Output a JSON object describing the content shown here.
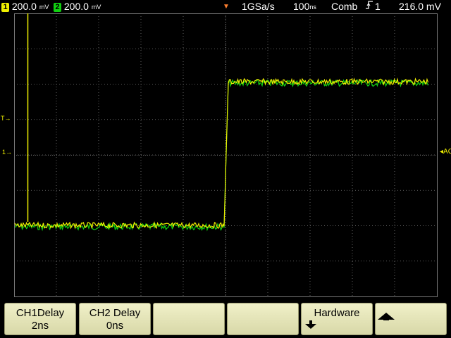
{
  "status": {
    "ch1_number": "1",
    "ch1_scale": "200.0",
    "ch1_unit": "mV",
    "ch2_number": "2",
    "ch2_scale": "200.0",
    "ch2_unit": "mV",
    "sample_rate": "1GSa/s",
    "timebase": "100",
    "timebase_unit": "ns",
    "acq_mode": "Comb",
    "trigger_slope_icon": "rising-edge-icon",
    "trigger_source": "1",
    "trigger_level": "216.0 mV"
  },
  "markers": {
    "trigger_pos_icon": "trigger-position-icon",
    "trigger_level_label": "T",
    "ground_label": "1",
    "ac_label": "AC"
  },
  "colors": {
    "ch1": "#f0f000",
    "ch2": "#10d010",
    "grid": "#7a7a7a",
    "trigger_marker": "#ff8030"
  },
  "softkeys": [
    {
      "line1": "CH1Delay",
      "line2": "2ns"
    },
    {
      "line1": "CH2 Delay",
      "line2": "0ns"
    },
    {
      "line1": "",
      "line2": ""
    },
    {
      "line1": "",
      "line2": ""
    },
    {
      "line1": "Hardware",
      "line2": ""
    },
    {
      "line1": "",
      "line2": ""
    }
  ],
  "softkey_icons": [
    "",
    "",
    "",
    "",
    "down-arrow-icon",
    "up-arrow-icon"
  ]
}
